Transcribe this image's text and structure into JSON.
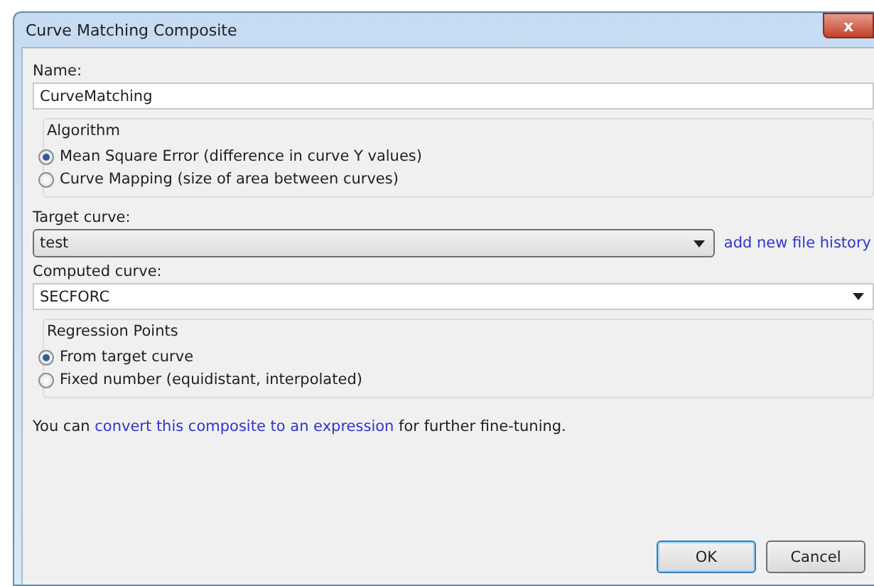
{
  "window": {
    "title": "Curve Matching Composite",
    "close": "x"
  },
  "name": {
    "label": "Name:",
    "value": "CurveMatching"
  },
  "algorithm": {
    "title": "Algorithm",
    "options": [
      {
        "label": "Mean Square Error (difference in curve Y values)",
        "selected": true
      },
      {
        "label": "Curve Mapping (size of area between curves)",
        "selected": false
      }
    ]
  },
  "target_curve": {
    "label": "Target curve:",
    "value": "test",
    "link": "add new file history"
  },
  "computed_curve": {
    "label": "Computed curve:",
    "value": "SECFORC"
  },
  "regression_points": {
    "title": "Regression Points",
    "options": [
      {
        "label": "From target curve",
        "selected": true
      },
      {
        "label": "Fixed number (equidistant, interpolated)",
        "selected": false
      }
    ]
  },
  "note": {
    "before": "You can ",
    "link": "convert this composite to an expression",
    "after": " for further fine-tuning."
  },
  "buttons": [
    {
      "label": "OK",
      "default": true
    },
    {
      "label": "Cancel",
      "default": false
    }
  ]
}
